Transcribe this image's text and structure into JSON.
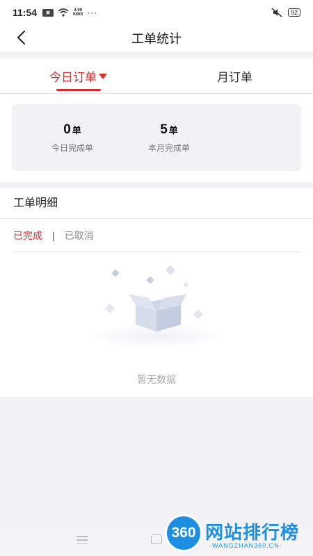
{
  "status_bar": {
    "time": "11:54",
    "speed_top": "4.00",
    "speed_bottom": "KB/S",
    "dots": "···",
    "battery": "92"
  },
  "navbar": {
    "title": "工单统计"
  },
  "tabs": [
    {
      "label": "今日订单",
      "active": true
    },
    {
      "label": "月订单",
      "active": false
    }
  ],
  "stats": {
    "today": {
      "value": "0",
      "unit": "单",
      "label": "今日完成单"
    },
    "month": {
      "value": "5",
      "unit": "单",
      "label": "本月完成单"
    }
  },
  "detail": {
    "title": "工单明细",
    "filter_done": "已完成",
    "filter_separator": "|",
    "filter_cancel": "已取消",
    "empty_text": "暂无数据"
  },
  "watermark": {
    "badge": "360",
    "title": "网站排行榜",
    "subtitle": "-WANGZHAN360.CN-"
  },
  "colors": {
    "accent": "#d62c2c",
    "watermark": "#1d8fe3"
  }
}
